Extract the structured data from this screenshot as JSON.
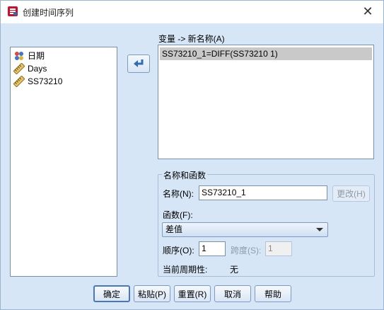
{
  "window": {
    "title": "创建时间序列",
    "close_glyph": "✕"
  },
  "variables": {
    "items": [
      {
        "label": "日期",
        "icon": "date-variable-icon"
      },
      {
        "label": "Days",
        "icon": "scale-variable-icon"
      },
      {
        "label": "SS73210",
        "icon": "scale-variable-icon"
      }
    ]
  },
  "target": {
    "label": "变量 -> 新名称(A)",
    "items": [
      "SS73210_1=DIFF(SS73210 1)"
    ]
  },
  "group": {
    "title": "名称和函数",
    "name_label": "名称(N):",
    "name_value": "SS73210_1",
    "change_button": "更改(H)",
    "function_label": "函数(F):",
    "function_value": "差值",
    "order_label": "顺序(O):",
    "order_value": "1",
    "span_label": "跨度(S):",
    "span_value": "1",
    "period_label": "当前周期性:",
    "period_value": "无"
  },
  "buttons": {
    "ok": "确定",
    "paste": "粘贴(P)",
    "reset": "重置(R)",
    "cancel": "取消",
    "help": "帮助"
  },
  "colors": {
    "dialog_bg": "#d6e6f7",
    "selection": "#c9c9c9",
    "accent": "#2f6db5"
  }
}
